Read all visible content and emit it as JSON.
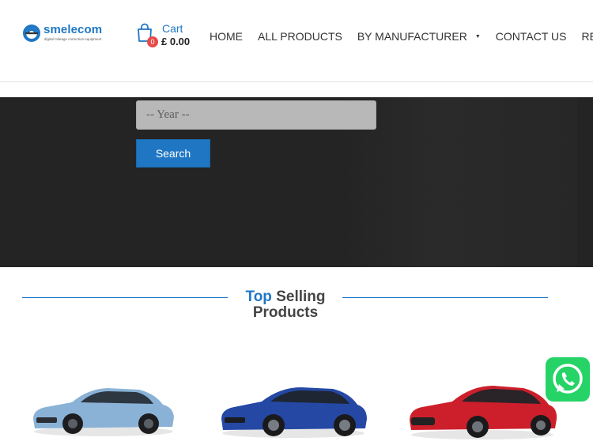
{
  "header": {
    "logo": {
      "name": "smelecom",
      "tagline": "digital mileage correction equipment"
    },
    "cart": {
      "label": "Cart",
      "count": "0",
      "total": "£ 0.00"
    },
    "nav": [
      {
        "label": "HOME"
      },
      {
        "label": "ALL PRODUCTS"
      },
      {
        "label": "BY MANUFACTURER",
        "dropdown": true
      },
      {
        "label": "CONTACT US"
      },
      {
        "label": "REGISTER"
      }
    ]
  },
  "search": {
    "year_placeholder": "-- Year --",
    "button_label": "Search"
  },
  "section": {
    "title_accent": "Top",
    "title_rest": "Selling",
    "title_line2": "Products"
  },
  "products": [
    {
      "color": "#8ab2d6"
    },
    {
      "color": "#2448a4"
    },
    {
      "color": "#cc1f2b"
    }
  ],
  "colors": {
    "brand": "#1f77c4",
    "hero_bg": "#242424",
    "whatsapp": "#25d366"
  },
  "icons": {
    "cart": "shopping-bag-icon",
    "whatsapp": "whatsapp-icon"
  }
}
